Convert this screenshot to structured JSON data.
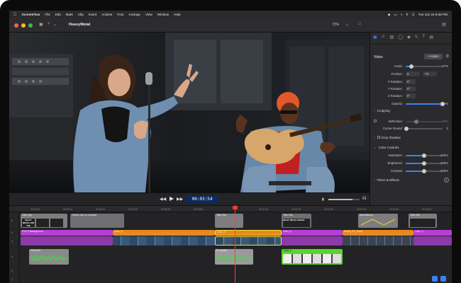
{
  "menubar": {
    "app_name": "ScreenFlow",
    "items": [
      "File",
      "Edit",
      "Mark",
      "Clip",
      "Insert",
      "Actions",
      "Font",
      "Arrange",
      "View",
      "Window",
      "Help"
    ],
    "datetime": "Tue Jun 15 8:46 PM"
  },
  "window": {
    "title": "HeavyMetal",
    "zoom": "72%",
    "traffic_colors": [
      "#ff5f57",
      "#febc2e",
      "#28c840"
    ]
  },
  "transport": {
    "timecode": "00:03:54"
  },
  "inspector": {
    "tabs": [
      "video-icon",
      "audio-icon",
      "screen-icon",
      "callout-icon",
      "touch-icon",
      "annotation-icon",
      "text-icon",
      "media-icon"
    ],
    "header": "Video",
    "action_label": "+ Action",
    "rows": {
      "scale": {
        "label": "Scale:",
        "value": "67%",
        "level": 0.15
      },
      "position": {
        "label": "Position:",
        "x": "0",
        "y": "-73"
      },
      "x_rotation": {
        "label": "X Rotation:",
        "value": "0°"
      },
      "y_rotation": {
        "label": "Y Rotation:",
        "value": "0°"
      },
      "z_rotation": {
        "label": "Z Rotation:",
        "value": "0°"
      },
      "opacity": {
        "label": "Opacity:",
        "value": "100%",
        "level": 1.0
      },
      "reflection": {
        "label": "Reflection:",
        "value": "25%"
      },
      "corner_round": {
        "label": "Corner Round:",
        "value": "0"
      },
      "saturation": {
        "label": "Saturation:",
        "value": "100%",
        "level": 0.5
      },
      "brightness": {
        "label": "Brightness:",
        "value": "100%",
        "level": 0.5
      },
      "contrast": {
        "label": "Contrast:",
        "value": "100%",
        "level": 0.5
      }
    },
    "sections": {
      "cropping": "Cropping",
      "drop_shadow": "Drop Shadow",
      "color_controls": "Color Controls",
      "filters": "Filters & Effects"
    }
  },
  "timeline": {
    "ruler_ticks": [
      "00:00:00",
      "00:00:10",
      "00:00:20",
      "00:00:30",
      "00:00:40",
      "00:00:50",
      "00:01:00",
      "00:01:10",
      "00:01:20",
      "00:01:30",
      "00:01:40",
      "00:01:50",
      "00:02:00"
    ],
    "track_numbers": [
      "6",
      "5",
      "4",
      "3",
      "2",
      "1"
    ],
    "clips": {
      "title_clip_1": "Title Clip",
      "heavy_metal_text": "HEAVY METAL FOR THE MASSES",
      "yellow_clip_text": "Yellow clip-on rockstar",
      "title_clip_2": "Title Clip",
      "heavy_metal_text_2": "HEAVY METAL MOVES",
      "annotations": "Annotations",
      "title_clip_3": "Title Clip",
      "purple_1": "Fd-Fe Background",
      "orange_1": "Cam_3",
      "selected": "Cam_3",
      "orange_2": "Cam_2",
      "purple_2": "Cam_4",
      "orange_3": "Audio_Fx_Track",
      "audio_1": "Final Mix",
      "audio_2": "Fx_Audio",
      "green_clip": "Cam_9"
    }
  },
  "colors": {
    "accent": "#3b82f6",
    "clip_purple": "#b53fd4",
    "clip_orange": "#e8891f",
    "clip_green": "#5ad42a",
    "clip_gray": "#8a8a8a",
    "playhead": "#ff3b30"
  }
}
